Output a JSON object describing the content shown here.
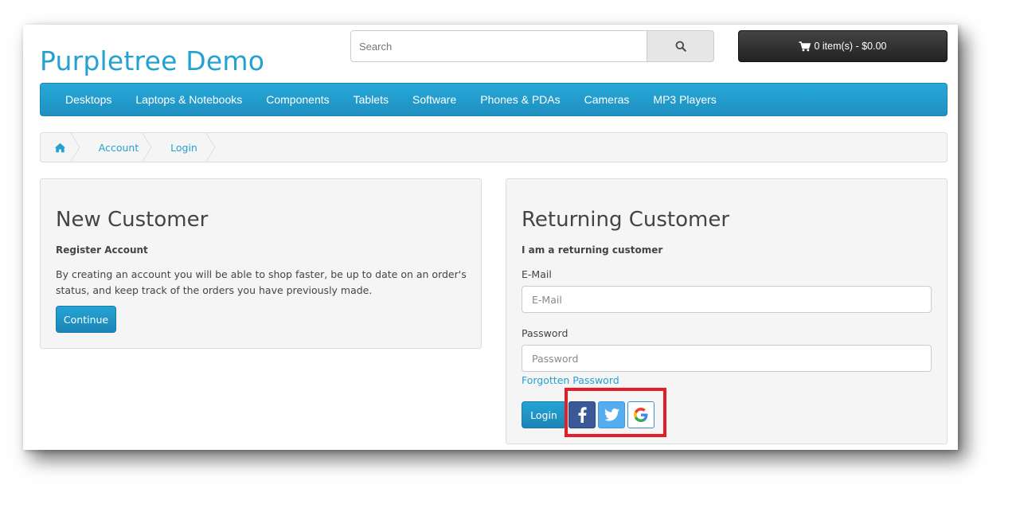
{
  "store": {
    "logo": "Purpletree Demo"
  },
  "search": {
    "placeholder": "Search"
  },
  "cart": {
    "label": "0 item(s) - $0.00"
  },
  "menu": {
    "items": [
      "Desktops",
      "Laptops & Notebooks",
      "Components",
      "Tablets",
      "Software",
      "Phones & PDAs",
      "Cameras",
      "MP3 Players"
    ]
  },
  "breadcrumb": {
    "items": [
      "Account",
      "Login"
    ]
  },
  "new_customer": {
    "title": "New Customer",
    "subtitle": "Register Account",
    "description": "By creating an account you will be able to shop faster, be up to date on an order's status, and keep track of the orders you have previously made.",
    "continue_label": "Continue"
  },
  "returning_customer": {
    "title": "Returning Customer",
    "subtitle": "I am a returning customer",
    "email_label": "E-Mail",
    "email_placeholder": "E-Mail",
    "password_label": "Password",
    "password_placeholder": "Password",
    "forgotten_label": "Forgotten Password",
    "login_label": "Login"
  },
  "social": {
    "icons": [
      "facebook-icon",
      "twitter-icon",
      "google-icon"
    ],
    "highlight_color": "#e31e26"
  },
  "colors": {
    "accent": "#23a1d1",
    "facebook": "#3b5998",
    "twitter": "#55acee"
  }
}
